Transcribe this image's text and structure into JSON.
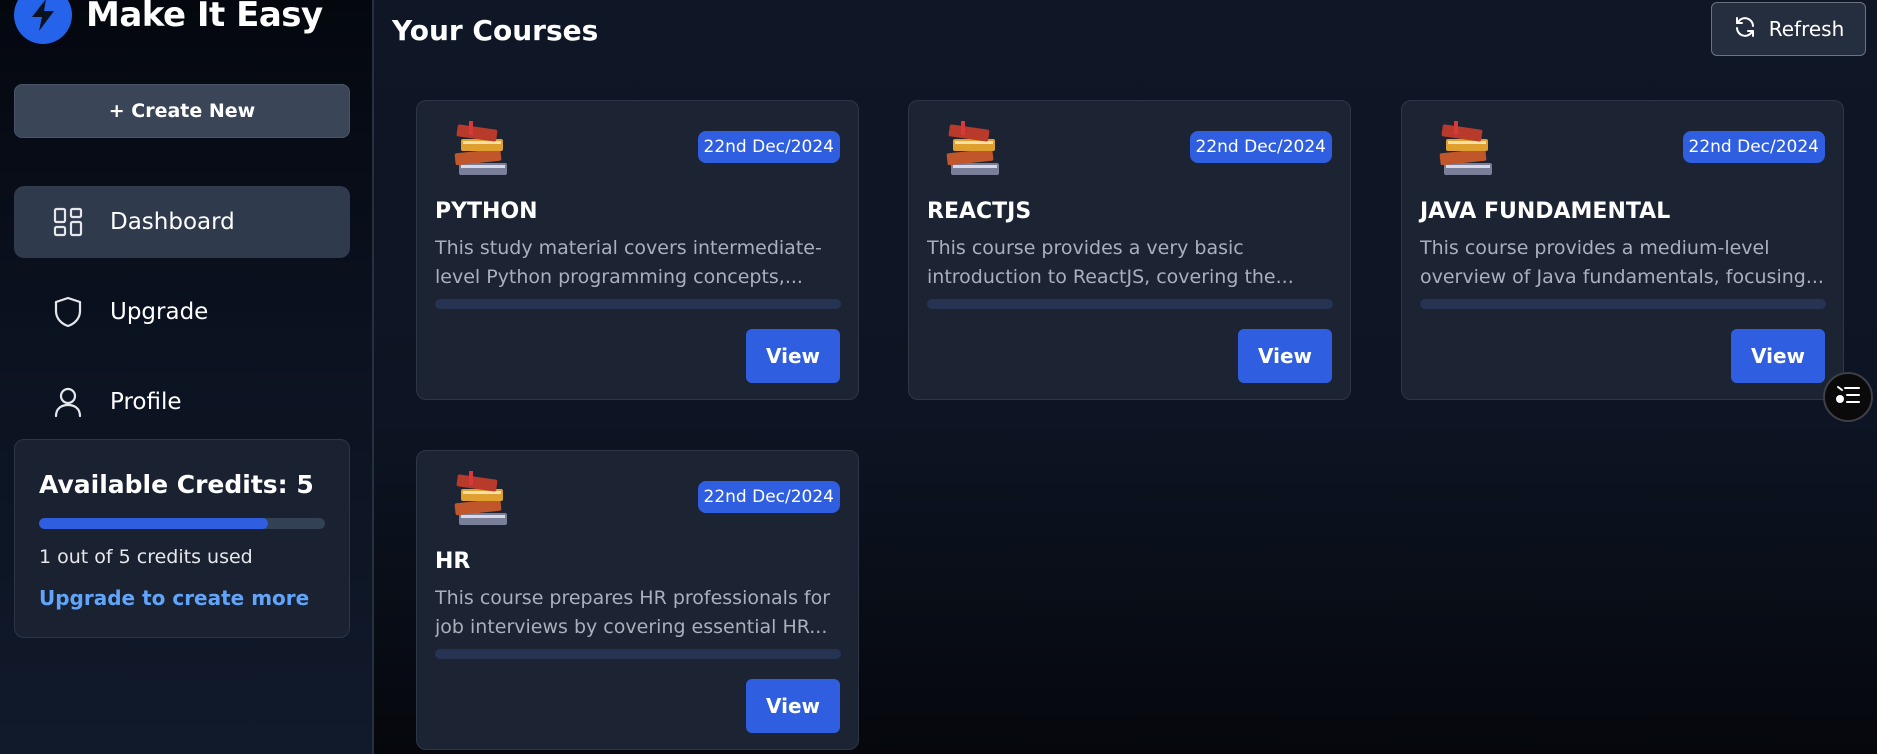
{
  "brand": {
    "name": "Make It Easy",
    "logo_icon": "lightning-bolt-icon",
    "logo_color": "#2563eb"
  },
  "sidebar": {
    "create_label": "+ Create New",
    "items": [
      {
        "label": "Dashboard",
        "icon": "grid-icon",
        "active": true
      },
      {
        "label": "Upgrade",
        "icon": "shield-icon",
        "active": false
      },
      {
        "label": "Profile",
        "icon": "user-icon",
        "active": false
      }
    ]
  },
  "credits": {
    "title": "Available Credits: 5",
    "used_fraction": 0.8,
    "used_text": "1 out of 5 credits used",
    "upgrade_link": "Upgrade to create more"
  },
  "main": {
    "title": "Your Courses",
    "refresh_label": "Refresh",
    "courses": [
      {
        "title": "PYTHON",
        "date": "22nd Dec/2024",
        "description": "This study material covers intermediate-level Python programming concepts,...",
        "view_label": "View"
      },
      {
        "title": "REACTJS",
        "date": "22nd Dec/2024",
        "description": "This course provides a very basic introduction to ReactJS, covering the...",
        "view_label": "View"
      },
      {
        "title": "JAVA FUNDAMENTAL",
        "date": "22nd Dec/2024",
        "description": "This course provides a medium-level overview of Java fundamentals, focusing...",
        "view_label": "View"
      },
      {
        "title": "HR",
        "date": "22nd Dec/2024",
        "description": "This course prepares HR professionals for job interviews by covering essential HR...",
        "view_label": "View"
      }
    ]
  },
  "colors": {
    "accent": "#2f5fe0",
    "link": "#60a5fa",
    "card_bg": "#1c2433"
  }
}
